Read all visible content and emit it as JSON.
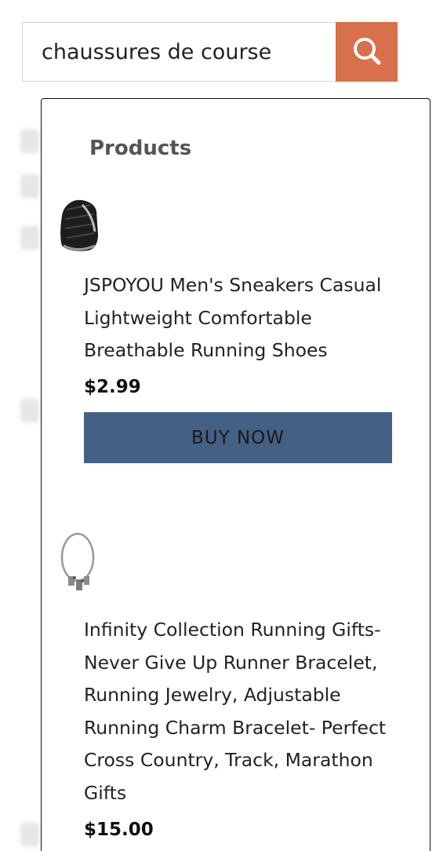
{
  "search": {
    "value": "chaussures de course",
    "icon": "search-icon"
  },
  "colors": {
    "search_button": "#d8704b",
    "buy_button": "#446084",
    "section_title": "#555555"
  },
  "dropdown": {
    "section_title": "Products",
    "products": [
      {
        "title": "JSPOYOU Men's Sneakers Casual Lightweight Comfortable Breathable Running Shoes",
        "price": "$2.99",
        "button_label": "BUY NOW",
        "image": "sneaker-thumbnail"
      },
      {
        "title": "Infinity Collection Running Gifts- Never Give Up Runner Bracelet, Running Jewelry, Adjustable Running Charm Bracelet- Perfect Cross Country, Track, Marathon Gifts",
        "price": "$15.00",
        "image": "bracelet-thumbnail"
      }
    ]
  }
}
